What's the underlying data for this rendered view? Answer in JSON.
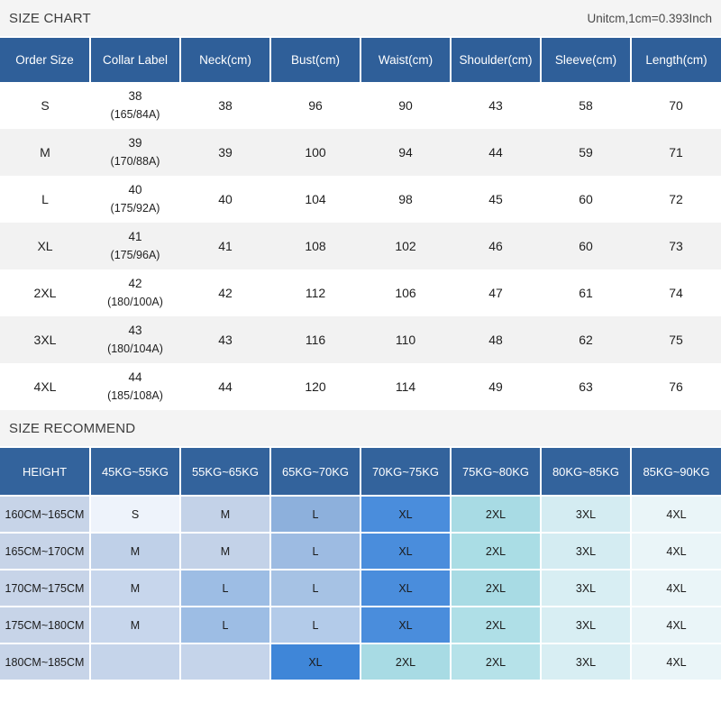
{
  "size_chart": {
    "title": "SIZE CHART",
    "unit_note": "Unitcm,1cm=0.393Inch",
    "columns": [
      "Order Size",
      "Collar Label",
      "Neck(cm)",
      "Bust(cm)",
      "Waist(cm)",
      "Shoulder(cm)",
      "Sleeve(cm)",
      "Length(cm)"
    ],
    "rows": [
      {
        "order_size": "S",
        "collar_label": "38",
        "collar_code": "(165/84A)",
        "neck": "38",
        "bust": "96",
        "waist": "90",
        "shoulder": "43",
        "sleeve": "58",
        "length": "70"
      },
      {
        "order_size": "M",
        "collar_label": "39",
        "collar_code": "(170/88A)",
        "neck": "39",
        "bust": "100",
        "waist": "94",
        "shoulder": "44",
        "sleeve": "59",
        "length": "71"
      },
      {
        "order_size": "L",
        "collar_label": "40",
        "collar_code": "(175/92A)",
        "neck": "40",
        "bust": "104",
        "waist": "98",
        "shoulder": "45",
        "sleeve": "60",
        "length": "72"
      },
      {
        "order_size": "XL",
        "collar_label": "41",
        "collar_code": "(175/96A)",
        "neck": "41",
        "bust": "108",
        "waist": "102",
        "shoulder": "46",
        "sleeve": "60",
        "length": "73"
      },
      {
        "order_size": "2XL",
        "collar_label": "42",
        "collar_code": "(180/100A)",
        "neck": "42",
        "bust": "112",
        "waist": "106",
        "shoulder": "47",
        "sleeve": "61",
        "length": "74"
      },
      {
        "order_size": "3XL",
        "collar_label": "43",
        "collar_code": "(180/104A)",
        "neck": "43",
        "bust": "116",
        "waist": "110",
        "shoulder": "48",
        "sleeve": "62",
        "length": "75"
      },
      {
        "order_size": "4XL",
        "collar_label": "44",
        "collar_code": "(185/108A)",
        "neck": "44",
        "bust": "120",
        "waist": "114",
        "shoulder": "49",
        "sleeve": "63",
        "length": "76"
      }
    ]
  },
  "size_recommend": {
    "title": "SIZE RECOMMEND",
    "columns": [
      "HEIGHT",
      "45KG~55KG",
      "55KG~65KG",
      "65KG~70KG",
      "70KG~75KG",
      "75KG~80KG",
      "80KG~85KG",
      "85KG~90KG"
    ],
    "rows": [
      {
        "height": "160CM~165CM",
        "cells": [
          {
            "label": "S",
            "color": "#eef3fb"
          },
          {
            "label": "M",
            "color": "#c3d2e8"
          },
          {
            "label": "L",
            "color": "#8db0dc"
          },
          {
            "label": "XL",
            "color": "#4a8ddc"
          },
          {
            "label": "2XL",
            "color": "#a8dbe4"
          },
          {
            "label": "3XL",
            "color": "#d4ecf2"
          },
          {
            "label": "4XL",
            "color": "#eaf5f8"
          }
        ]
      },
      {
        "height": "165CM~170CM",
        "cells": [
          {
            "label": "M",
            "color": "#bfd0e8"
          },
          {
            "label": "M",
            "color": "#c3d2e8"
          },
          {
            "label": "L",
            "color": "#9dbbe2"
          },
          {
            "label": "XL",
            "color": "#4a8ddc"
          },
          {
            "label": "2XL",
            "color": "#aadde5"
          },
          {
            "label": "3XL",
            "color": "#d4ecf2"
          },
          {
            "label": "4XL",
            "color": "#eaf5f8"
          }
        ]
      },
      {
        "height": "170CM~175CM",
        "cells": [
          {
            "label": "M",
            "color": "#c7d6ec"
          },
          {
            "label": "L",
            "color": "#9dbde4"
          },
          {
            "label": "L",
            "color": "#a6c2e4"
          },
          {
            "label": "XL",
            "color": "#4a8ddc"
          },
          {
            "label": "2XL",
            "color": "#a8dbe4"
          },
          {
            "label": "3XL",
            "color": "#d8eef3"
          },
          {
            "label": "4XL",
            "color": "#eaf5f8"
          }
        ]
      },
      {
        "height": "175CM~180CM",
        "cells": [
          {
            "label": "M",
            "color": "#c7d6ec"
          },
          {
            "label": "L",
            "color": "#9dbde4"
          },
          {
            "label": "L",
            "color": "#b3cbe9"
          },
          {
            "label": "XL",
            "color": "#4a8ddc"
          },
          {
            "label": "2XL",
            "color": "#afdfe7"
          },
          {
            "label": "3XL",
            "color": "#d8eef3"
          },
          {
            "label": "4XL",
            "color": "#eaf5f8"
          }
        ]
      },
      {
        "height": "180CM~185CM",
        "cells": [
          {
            "label": "",
            "color": "#c5d4ea"
          },
          {
            "label": "",
            "color": "#c5d4ea"
          },
          {
            "label": "XL",
            "color": "#3f86d8"
          },
          {
            "label": "2XL",
            "color": "#a8dbe4"
          },
          {
            "label": "2XL",
            "color": "#b6e2e9"
          },
          {
            "label": "3XL",
            "color": "#d8eef3"
          },
          {
            "label": "4XL",
            "color": "#eaf5f8"
          }
        ]
      }
    ]
  }
}
